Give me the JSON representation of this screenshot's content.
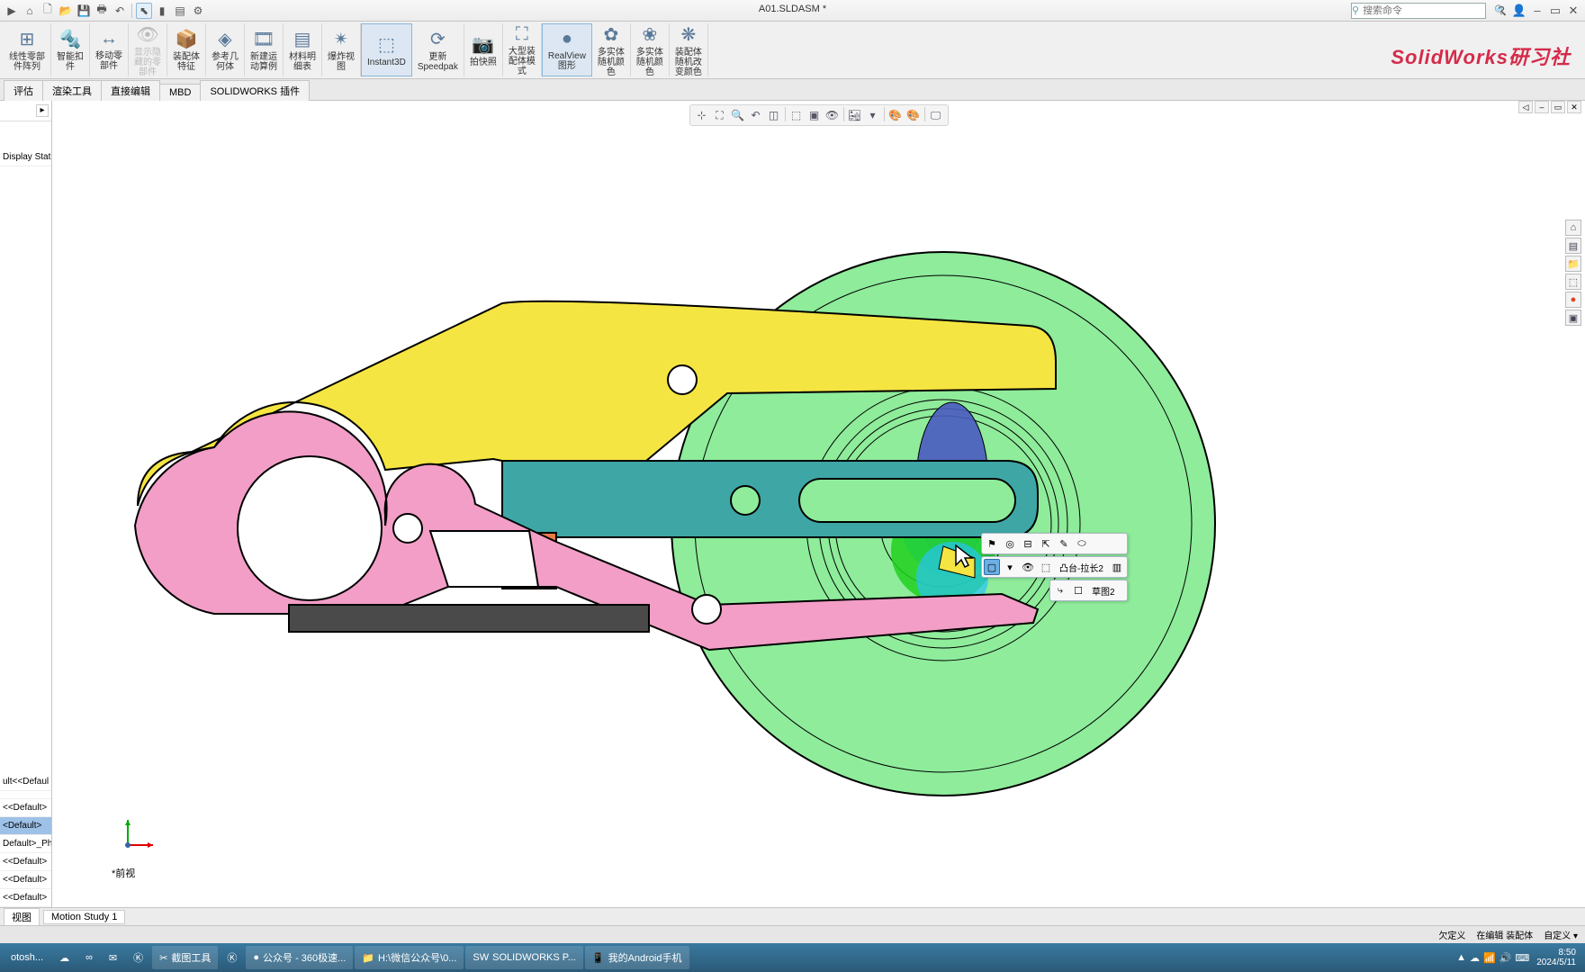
{
  "title": "A01.SLDASM *",
  "search_placeholder": "搜索命令",
  "watermark": "SolidWorks研习社",
  "menubar_icons": [
    "home",
    "new",
    "open",
    "save",
    "print",
    "undo",
    "redo-sel",
    "rebuild",
    "options",
    "gear"
  ],
  "ribbon": [
    {
      "label": "线性零部\n件阵列",
      "icon": "⊞",
      "en": false
    },
    {
      "label": "智能扣\n件",
      "icon": "🔩",
      "en": false
    },
    {
      "label": "移动零\n部件",
      "icon": "↔",
      "en": false
    },
    {
      "label": "显示隐\n藏的零\n部件",
      "icon": "👁",
      "en": false,
      "dis": true
    },
    {
      "label": "装配体\n特征",
      "icon": "📦",
      "en": false
    },
    {
      "label": "参考几\n何体",
      "icon": "◈",
      "en": false
    },
    {
      "label": "新建运\n动算例",
      "icon": "🎞",
      "en": false
    },
    {
      "label": "材料明\n细表",
      "icon": "▤",
      "en": false
    },
    {
      "label": "爆炸视\n图",
      "icon": "✴",
      "en": false
    },
    {
      "label": "Instant3D",
      "icon": "⬚",
      "en": false,
      "active": true
    },
    {
      "label": "更新\nSpeedpak",
      "icon": "⟳",
      "en": false
    },
    {
      "label": "拍快照",
      "icon": "📷",
      "en": false
    },
    {
      "label": "大型装\n配体模\n式",
      "icon": "⛶",
      "en": false
    },
    {
      "label": "RealView\n图形",
      "icon": "●",
      "en": false,
      "active": true
    },
    {
      "label": "多实体\n随机颜\n色",
      "icon": "✿",
      "en": false
    },
    {
      "label": "多实体\n随机颜\n色",
      "icon": "❀",
      "en": false
    },
    {
      "label": "装配体\n随机改\n变颜色",
      "icon": "❋",
      "en": false
    }
  ],
  "subtabs": [
    "评估",
    "渲染工具",
    "直接编辑",
    "MBD",
    "SOLIDWORKS 插件"
  ],
  "left": {
    "header_label": "Display Stat",
    "items": [
      {
        "t": "ult<<Defaul"
      },
      {
        "t": ""
      },
      {
        "t": "<<Default>"
      },
      {
        "t": "<Default>",
        "sel": true
      },
      {
        "t": "Default>_Ph"
      },
      {
        "t": "<<Default>"
      },
      {
        "t": "<<Default>"
      },
      {
        "t": "<<Default>"
      }
    ]
  },
  "view_label": "*前视",
  "bottom_tabs": [
    "视图",
    "Motion Study 1"
  ],
  "status": [
    "欠定义",
    "在编辑 装配体",
    "自定义 ▾"
  ],
  "ctx": {
    "row2": {
      "label": "凸台-拉长2"
    },
    "row3": {
      "label": "草图2"
    }
  },
  "taskbar": {
    "items": [
      {
        "t": "otosh...",
        "light": false
      },
      {
        "t": "",
        "icon": "☁"
      },
      {
        "t": "",
        "icon": "∞"
      },
      {
        "t": "",
        "icon": "✉"
      },
      {
        "t": "",
        "icon": "Ⓚ"
      },
      {
        "t": "截图工具",
        "icon": "✂",
        "light": true
      },
      {
        "t": "",
        "icon": "Ⓚ"
      },
      {
        "t": "公众号 - 360极速...",
        "icon": "●",
        "light": true
      },
      {
        "t": "H:\\微信公众号\\0...",
        "icon": "📁",
        "light": true
      },
      {
        "t": "SOLIDWORKS P...",
        "icon": "SW",
        "light": true
      },
      {
        "t": "我的Android手机",
        "icon": "📱",
        "light": true
      }
    ],
    "time": "8:50",
    "date": "2024/5/11"
  }
}
